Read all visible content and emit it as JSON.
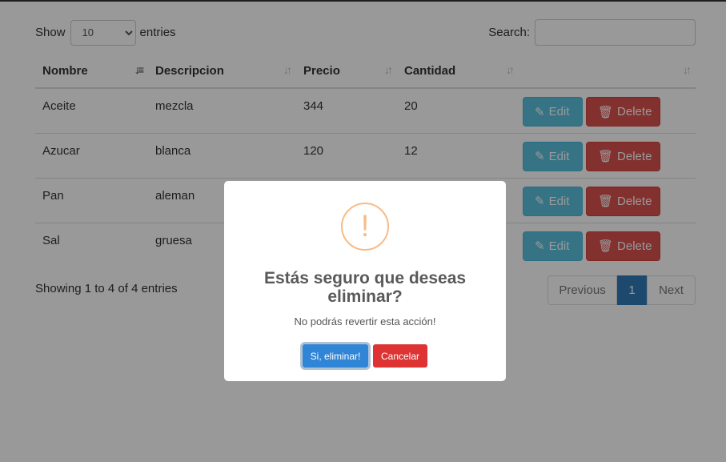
{
  "datatable": {
    "show_label": "Show",
    "page_length": "10",
    "entries_label": "entries",
    "search_label": "Search:",
    "search_value": "",
    "columns": [
      "Nombre",
      "Descripcion",
      "Precio",
      "Cantidad",
      ""
    ],
    "rows": [
      {
        "nombre": "Aceite",
        "descripcion": "mezcla",
        "precio": "344",
        "cantidad": "20"
      },
      {
        "nombre": "Azucar",
        "descripcion": "blanca",
        "precio": "120",
        "cantidad": "12"
      },
      {
        "nombre": "Pan",
        "descripcion": "aleman",
        "precio": "",
        "cantidad": ""
      },
      {
        "nombre": "Sal",
        "descripcion": "gruesa",
        "precio": "",
        "cantidad": ""
      }
    ],
    "edit_label": "Edit",
    "delete_label": "Delete",
    "info": "Showing 1 to 4 of 4 entries",
    "pagination": {
      "previous": "Previous",
      "current": "1",
      "next": "Next"
    }
  },
  "dialog": {
    "icon": "!",
    "title": "Estás seguro que deseas eliminar?",
    "text": "No podrás revertir esta acción!",
    "confirm_label": "Si, eliminar!",
    "cancel_label": "Cancelar"
  },
  "icons": {
    "edit": "edit-icon",
    "delete": "trash-icon",
    "sort": "sort-icon"
  },
  "colors": {
    "edit": "#5bc0de",
    "delete": "#d9534f",
    "confirm": "#3085d6",
    "cancel": "#dd3333",
    "warning": "#f8bb86"
  }
}
